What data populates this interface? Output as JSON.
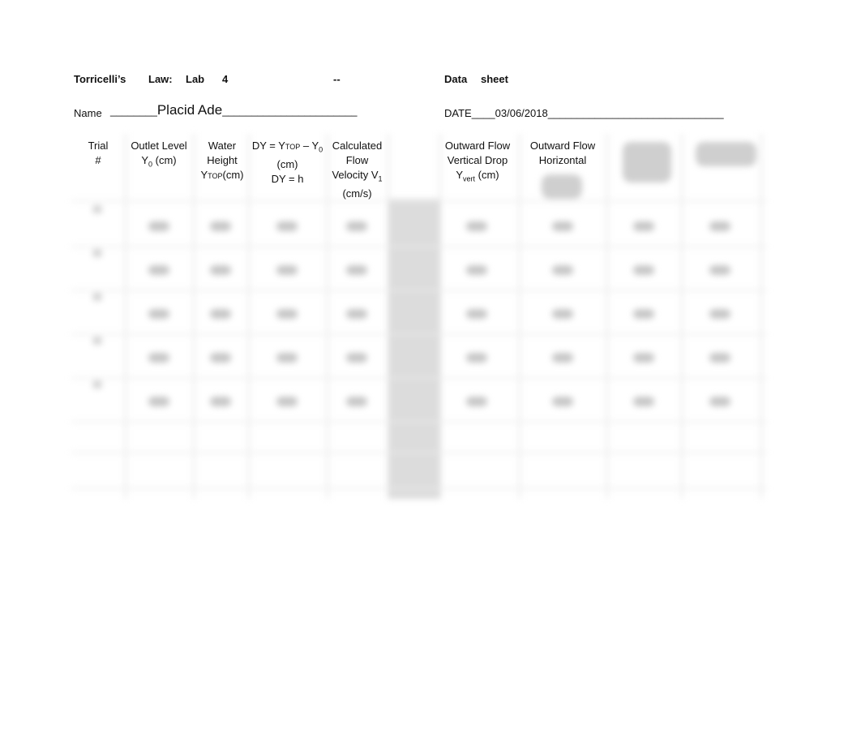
{
  "document": {
    "title_parts": [
      "Torricelli’s",
      "Law:",
      "Lab",
      "4",
      "--",
      "Data",
      "sheet"
    ],
    "name_label": "Name",
    "name_value": "Placid Ade",
    "date_label": "DATE",
    "date_value": "03/06/2018"
  },
  "table": {
    "headers": [
      {
        "lines": [
          "Trial",
          "#"
        ]
      },
      {
        "lines": [
          "Outlet Level",
          "Y₀ (cm)"
        ]
      },
      {
        "lines": [
          "Water",
          "Height",
          "YTOP(cm)"
        ]
      },
      {
        "lines": [
          "DY = YTOP – Y₀",
          "(cm)",
          "DY = h"
        ]
      },
      {
        "lines": [
          "Calculated",
          "Flow",
          "Velocity V₁",
          "(cm/s)"
        ]
      },
      {
        "lines": [
          ""
        ]
      },
      {
        "lines": [
          "Outward Flow",
          "Vertical Drop",
          "Yvert (cm)"
        ]
      },
      {
        "lines": [
          "Outward Flow",
          "Horizontal"
        ]
      },
      {
        "lines": [
          "[blurred]"
        ]
      },
      {
        "lines": [
          "[blurred]"
        ]
      }
    ],
    "rows_visible_blurred": 5,
    "rows_empty": 2
  }
}
